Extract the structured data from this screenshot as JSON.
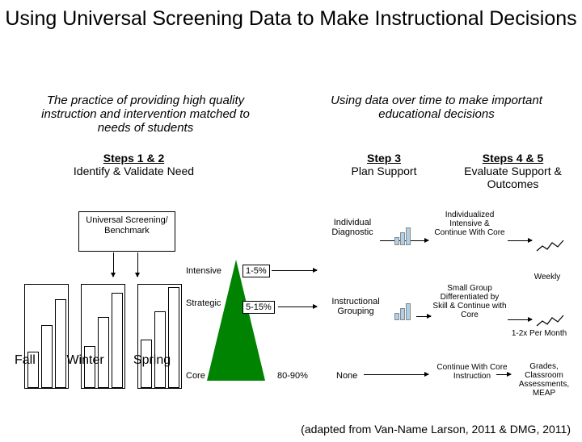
{
  "title": "Using Universal Screening Data to Make Instructional Decisions",
  "sub_left": "The practice of providing high quality instruction and intervention matched to needs of students",
  "sub_right": "Using data over time to make important educational decisions",
  "steps12_title": "Steps 1 & 2",
  "steps12_sub": "Identify & Validate Need",
  "step3_title": "Step 3",
  "step3_sub": "Plan Support",
  "step45_title": "Steps 4 & 5",
  "step45_sub": "Evaluate Support & Outcomes",
  "usb": "Universal Screening/ Benchmark",
  "seasons": {
    "fall": "Fall",
    "winter": "Winter",
    "spring": "Spring"
  },
  "tri": {
    "intensive": "Intensive",
    "strategic": "Strategic",
    "core": "Core"
  },
  "pct": {
    "p1": "1-5%",
    "p2": "5-15%",
    "p3": "80-90%"
  },
  "col4": {
    "ind": "Individual Diagnostic",
    "inst": "Instructional Grouping",
    "none": "None"
  },
  "col5": {
    "a": "Individualized Intensive & Continue With Core",
    "b": "Small Group Differentiated by Skill & Continue with Core",
    "c": "Continue With Core Instruction"
  },
  "freq": {
    "a": "Weekly",
    "b": "1-2x Per Month",
    "c": "Grades, Classroom Assessments, MEAP"
  },
  "credit": "(adapted from Van-Name Larson, 2011 & DMG, 2011)"
}
